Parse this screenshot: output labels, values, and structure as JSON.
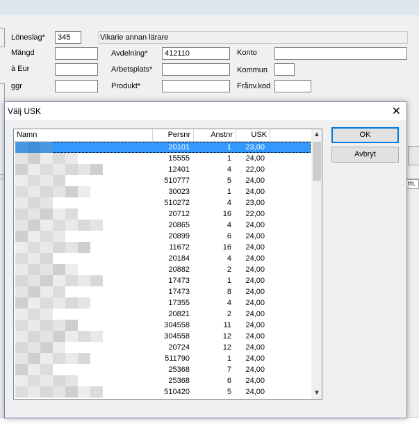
{
  "form": {
    "loneslag_label": "Löneslag*",
    "loneslag_value": "345",
    "loneslag_desc": "Vikarie annan lärare",
    "mangd_label": "Mängd",
    "a_eur_label": "à Eur",
    "ggr_label": "ggr",
    "avdelning_label": "Avdelning*",
    "avdelning_value": "412110",
    "arbetsplats_label": "Arbetsplats*",
    "produkt_label": "Produkt*",
    "konto_label": "Konto",
    "kommun_label": "Kommun",
    "franv_label": "Frånv.kod",
    "right_header": "m."
  },
  "dialog": {
    "title": "Välj USK",
    "ok_label": "OK",
    "cancel_label": "Avbryt",
    "columns": {
      "name": "Namn",
      "persnr": "Persnr",
      "anstnr": "Anstnr",
      "usk": "USK"
    },
    "rows": [
      {
        "persnr": "20101",
        "anstnr": "1",
        "usk": "23,00",
        "selected": true
      },
      {
        "persnr": "15555",
        "anstnr": "1",
        "usk": "24,00"
      },
      {
        "persnr": "12401",
        "anstnr": "4",
        "usk": "22,00"
      },
      {
        "persnr": "510777",
        "anstnr": "5",
        "usk": "24,00"
      },
      {
        "persnr": "30023",
        "anstnr": "1",
        "usk": "24,00"
      },
      {
        "persnr": "510272",
        "anstnr": "4",
        "usk": "23,00"
      },
      {
        "persnr": "20712",
        "anstnr": "16",
        "usk": "22,00"
      },
      {
        "persnr": "20865",
        "anstnr": "4",
        "usk": "24,00"
      },
      {
        "persnr": "20899",
        "anstnr": "6",
        "usk": "24,00"
      },
      {
        "persnr": "11672",
        "anstnr": "16",
        "usk": "24,00"
      },
      {
        "persnr": "20184",
        "anstnr": "4",
        "usk": "24,00"
      },
      {
        "persnr": "20882",
        "anstnr": "2",
        "usk": "24,00"
      },
      {
        "persnr": "17473",
        "anstnr": "1",
        "usk": "24,00"
      },
      {
        "persnr": "17473",
        "anstnr": "8",
        "usk": "24,00"
      },
      {
        "persnr": "17355",
        "anstnr": "4",
        "usk": "24,00"
      },
      {
        "persnr": "20821",
        "anstnr": "2",
        "usk": "24,00"
      },
      {
        "persnr": "304558",
        "anstnr": "11",
        "usk": "24,00"
      },
      {
        "persnr": "304558",
        "anstnr": "12",
        "usk": "24,00"
      },
      {
        "persnr": "20724",
        "anstnr": "12",
        "usk": "24,00"
      },
      {
        "persnr": "511790",
        "anstnr": "1",
        "usk": "24,00"
      },
      {
        "persnr": "25368",
        "anstnr": "7",
        "usk": "24,00"
      },
      {
        "persnr": "25368",
        "anstnr": "6",
        "usk": "24,00"
      },
      {
        "persnr": "510420",
        "anstnr": "5",
        "usk": "24,00"
      }
    ]
  },
  "colors": {
    "selection": "#3399ff",
    "default_button_border": "#0078d7"
  }
}
